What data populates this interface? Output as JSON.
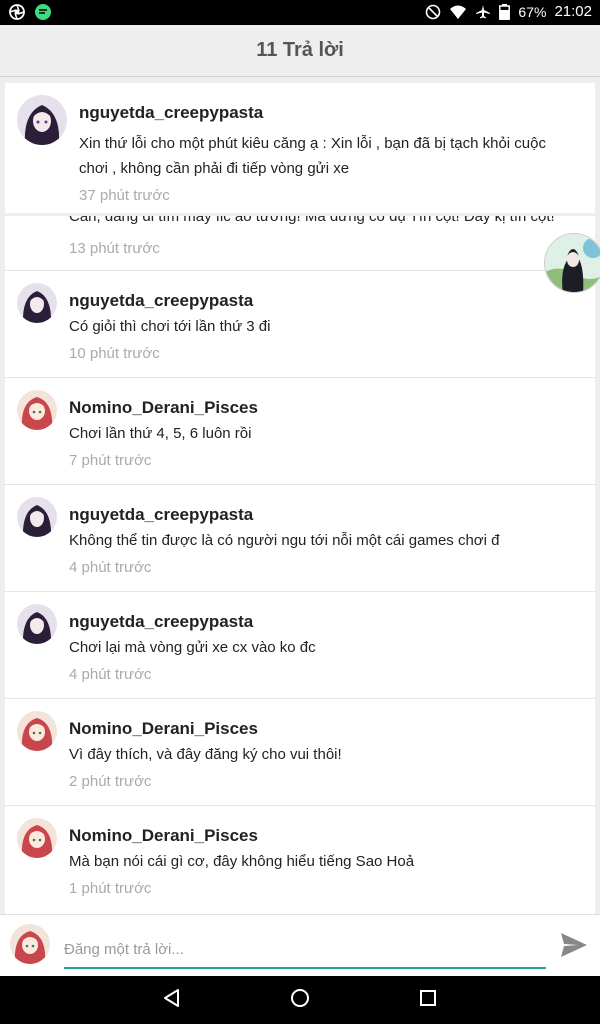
{
  "status_bar": {
    "battery": "67%",
    "time": "21:02",
    "icons": [
      "camera-aperture-icon",
      "chat-bubble-icon",
      "do-not-disturb-icon",
      "wifi-icon",
      "airplane-icon",
      "battery-icon"
    ]
  },
  "header": {
    "title": "11 Trả lời"
  },
  "first_comment": {
    "name": "nguyetda_creepypasta",
    "text_lines": [
      "Xin thứ lỗi cho một phút kiêu căng ạ : Xin lỗi , bạn đã bị tạch khỏi cuộc",
      "chơi , không cần phải đi tiếp vòng gửi xe"
    ],
    "time": "37 phút trước"
  },
  "partial_comment": {
    "text": "Cần, đang đi tìm mấy fic ảo tưởng! Mà đừng có dụ Tín cọt! Đây kị tín cọt!",
    "time": "13 phút trước"
  },
  "comments": [
    {
      "name": "nguyetda_creepypasta",
      "text": "Có giỏi thì chơi tới lần thứ 3 đi",
      "time": "10 phút trước",
      "avatar": "dark"
    },
    {
      "name": "Nomino_Derani_Pisces",
      "text": "Chơi lần thứ 4, 5, 6 luôn rồi",
      "time": "7 phút trước",
      "avatar": "red"
    },
    {
      "name": "nguyetda_creepypasta",
      "text": "Không thể tin được là có người ngu tới nỗi một cái games chơi đ",
      "time": "4 phút trước",
      "avatar": "dark"
    },
    {
      "name": "nguyetda_creepypasta",
      "text": "Chơi lại mà vòng gửi xe cx vào ko đc",
      "time": "4 phút trước",
      "avatar": "dark"
    },
    {
      "name": "Nomino_Derani_Pisces",
      "text": "Vì đây thích, và đây đăng ký cho vui thôi!",
      "time": "2 phút trước",
      "avatar": "red"
    },
    {
      "name": "Nomino_Derani_Pisces",
      "text": "Mà bạn nói cái gì cơ, đây không hiểu tiếng Sao Hoả",
      "time": "1 phút trước",
      "avatar": "red"
    }
  ],
  "reply": {
    "placeholder": "Đăng một trả lời..."
  },
  "colors": {
    "accent": "#26a69a",
    "header_bg": "#eeeeee",
    "muted": "#aaaaaa"
  },
  "nav": {
    "icons": [
      "back-icon",
      "home-icon",
      "recents-icon"
    ]
  }
}
